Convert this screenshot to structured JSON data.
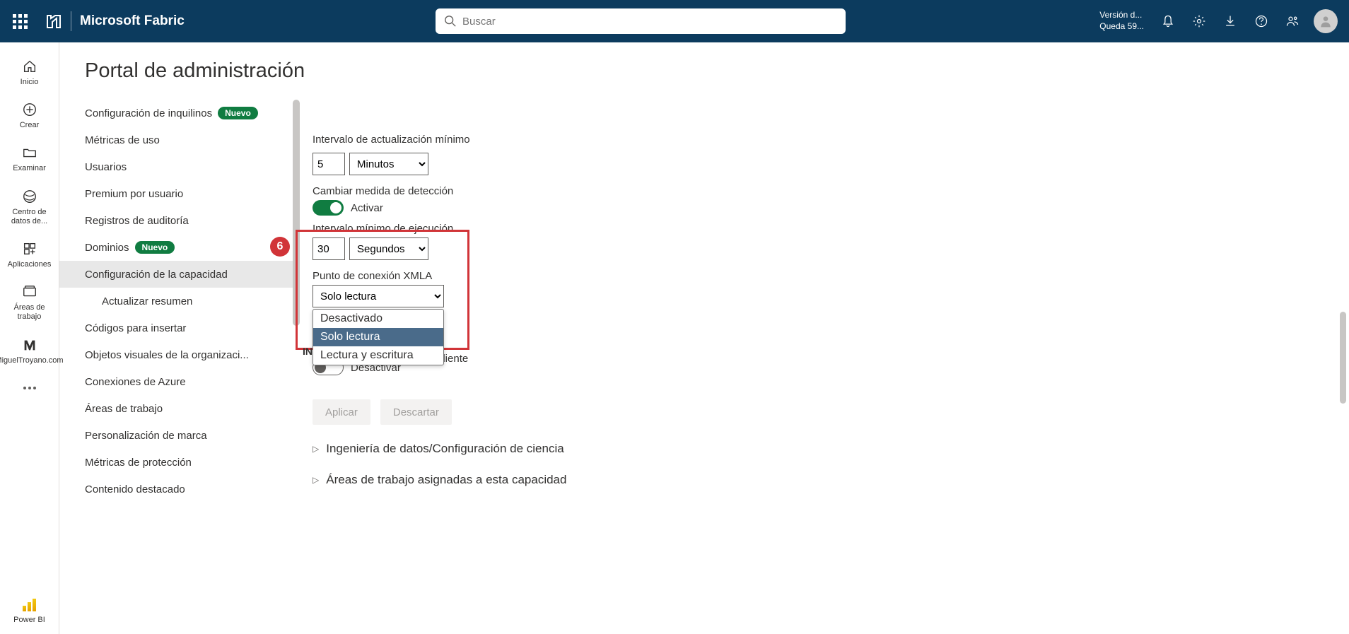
{
  "header": {
    "product": "Microsoft Fabric",
    "search_placeholder": "Buscar",
    "version_line1": "Versión d...",
    "version_line2": "Queda 59..."
  },
  "nav": {
    "items": [
      {
        "label": "Inicio",
        "icon": "home"
      },
      {
        "label": "Crear",
        "icon": "plus"
      },
      {
        "label": "Examinar",
        "icon": "folder"
      },
      {
        "label": "Centro de datos de...",
        "icon": "onelake"
      },
      {
        "label": "Aplicaciones",
        "icon": "apps"
      },
      {
        "label": "Áreas de trabajo",
        "icon": "workspaces"
      },
      {
        "label": "MiguelTroyano.com",
        "icon": "custom-m"
      }
    ],
    "more_label": "",
    "footer_label": "Power BI"
  },
  "page": {
    "title": "Portal de administración"
  },
  "sidebar": {
    "items": [
      {
        "label": "Configuración de inquilinos",
        "badge": "Nuevo"
      },
      {
        "label": "Métricas de uso"
      },
      {
        "label": "Usuarios"
      },
      {
        "label": "Premium por usuario"
      },
      {
        "label": "Registros de auditoría"
      },
      {
        "label": "Dominios",
        "badge": "Nuevo"
      },
      {
        "label": "Configuración de la capacidad",
        "selected": true
      },
      {
        "label": "Actualizar resumen",
        "sub": true
      },
      {
        "label": "Códigos para insertar"
      },
      {
        "label": "Objetos visuales de la organizaci..."
      },
      {
        "label": "Conexiones de Azure"
      },
      {
        "label": "Áreas de trabajo"
      },
      {
        "label": "Personalización de marca"
      },
      {
        "label": "Métricas de protección"
      },
      {
        "label": "Contenido destacado"
      }
    ]
  },
  "content": {
    "refresh_label": "Intervalo de actualización mínimo",
    "refresh_value": "5",
    "refresh_unit": "Minutos",
    "detection_label": "Cambiar medida de detección",
    "activate": "Activar",
    "exec_label": "Intervalo mínimo de ejecución",
    "exec_value": "30",
    "exec_unit": "Segundos",
    "xmla_label": "Punto de conexión XMLA",
    "xmla_value": "Solo lectura",
    "xmla_options": [
      "Desactivado",
      "Solo lectura",
      "Lectura y escritura"
    ],
    "callout_num": "6",
    "hidden_prefix": "IN",
    "hidden_suffix": "aliente",
    "deactivate": "Desactivar",
    "apply": "Aplicar",
    "discard": "Descartar",
    "expander1": "Ingeniería de datos/Configuración de ciencia",
    "expander2": "Áreas de trabajo asignadas a esta capacidad"
  }
}
